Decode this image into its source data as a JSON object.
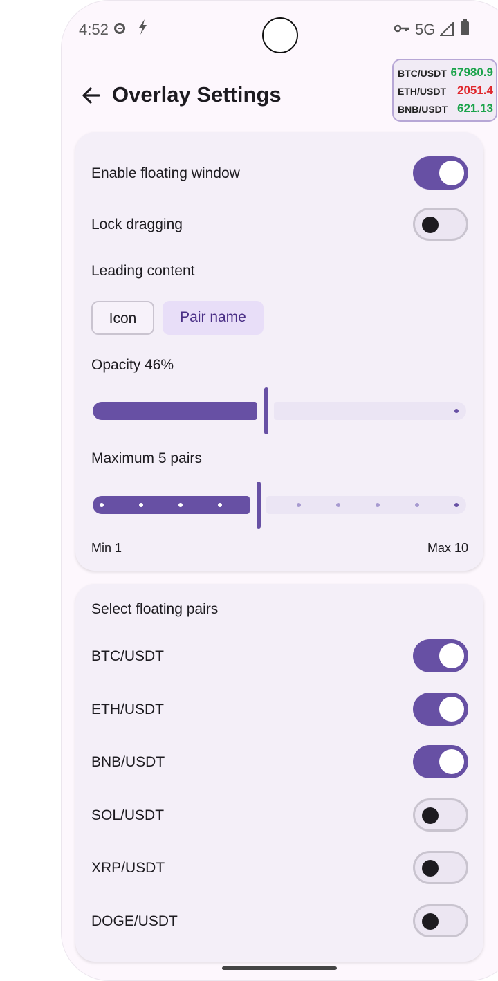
{
  "status_bar": {
    "time": "4:52",
    "network": "5G",
    "icons": [
      "do-not-disturb-icon",
      "bolt-icon",
      "vpn-key-icon",
      "signal-icon",
      "battery-icon"
    ]
  },
  "header": {
    "title": "Overlay Settings",
    "back_icon": "arrow-back-icon"
  },
  "floating_overlay": {
    "rows": [
      {
        "pair": "BTC/USDT",
        "price": "67980.9",
        "color": "#1aa34a"
      },
      {
        "pair": "ETH/USDT",
        "price": "2051.4",
        "color": "#e0262c"
      },
      {
        "pair": "BNB/USDT",
        "price": "621.13",
        "color": "#1aa34a"
      }
    ]
  },
  "settings": {
    "enable_floating_window": {
      "label": "Enable floating window",
      "on": true
    },
    "lock_dragging": {
      "label": "Lock dragging",
      "on": false
    },
    "leading_content": {
      "label": "Leading content",
      "options": [
        {
          "label": "Icon",
          "selected": false
        },
        {
          "label": "Pair name",
          "selected": true
        }
      ]
    },
    "opacity": {
      "label": "Opacity 46%",
      "value_percent": 46
    },
    "max_pairs": {
      "label": "Maximum 5 pairs",
      "value": 5,
      "min": 1,
      "max": 10,
      "min_label": "Min 1",
      "max_label": "Max 10"
    }
  },
  "pairs_section": {
    "title": "Select floating pairs",
    "pairs": [
      {
        "label": "BTC/USDT",
        "on": true
      },
      {
        "label": "ETH/USDT",
        "on": true
      },
      {
        "label": "BNB/USDT",
        "on": true
      },
      {
        "label": "SOL/USDT",
        "on": false
      },
      {
        "label": "XRP/USDT",
        "on": false
      },
      {
        "label": "DOGE/USDT",
        "on": false
      }
    ]
  },
  "colors": {
    "accent": "#6750a4",
    "up": "#1aa34a",
    "down": "#e0262c"
  }
}
